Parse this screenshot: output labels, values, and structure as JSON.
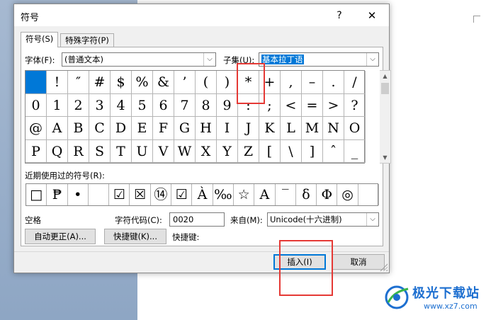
{
  "colors": {
    "accent": "#0078d7",
    "annotation": "#e53935",
    "watermark": "#1d6fd0"
  },
  "dialog": {
    "title": "符号",
    "help": "?",
    "close": "✕",
    "tabs": [
      {
        "label": "符号(S)"
      },
      {
        "label": "特殊字符(P)"
      }
    ],
    "font": {
      "label": "字体(F):",
      "value": "(普通文本)"
    },
    "subset": {
      "label": "子集(U):",
      "value": "基本拉丁语"
    },
    "grid": [
      [
        "",
        "!",
        "″",
        "#",
        "$",
        "%",
        "&",
        "’",
        "(",
        ")",
        "*",
        "+",
        ",",
        "–",
        ".",
        "/"
      ],
      [
        "0",
        "1",
        "2",
        "3",
        "4",
        "5",
        "6",
        "7",
        "8",
        "9",
        ":",
        ";",
        "<",
        "=",
        ">",
        "?"
      ],
      [
        "@",
        "A",
        "B",
        "C",
        "D",
        "E",
        "F",
        "G",
        "H",
        "I",
        "J",
        "K",
        "L",
        "M",
        "N",
        "O"
      ],
      [
        "P",
        "Q",
        "R",
        "S",
        "T",
        "U",
        "V",
        "W",
        "X",
        "Y",
        "Z",
        "[",
        "\\",
        "]",
        "ˆ",
        "_"
      ]
    ],
    "recent_label": "近期使用过的符号(R):",
    "recent": [
      "□",
      "₱",
      "•",
      "",
      "☑",
      "☒",
      "⑭",
      "☑",
      "À",
      "‰",
      "☆",
      "A",
      "‾",
      "δ",
      "Φ",
      "◎",
      ""
    ],
    "char_name": "空格",
    "char_code": {
      "label": "字符代码(C):",
      "value": "0020"
    },
    "from": {
      "label": "来自(M):",
      "value": "Unicode(十六进制)"
    },
    "buttons": {
      "autocorrect": "自动更正(A)...",
      "shortcut_key": "快捷键(K)...",
      "shortcut_text": "快捷键:",
      "insert": "插入(I)",
      "cancel": "取消"
    },
    "scroll_up": "▲",
    "scroll_down": "▼",
    "dropdown_arrow": "⌵"
  },
  "watermark": {
    "name": "极光下载站",
    "url": "www.xz7.com"
  }
}
